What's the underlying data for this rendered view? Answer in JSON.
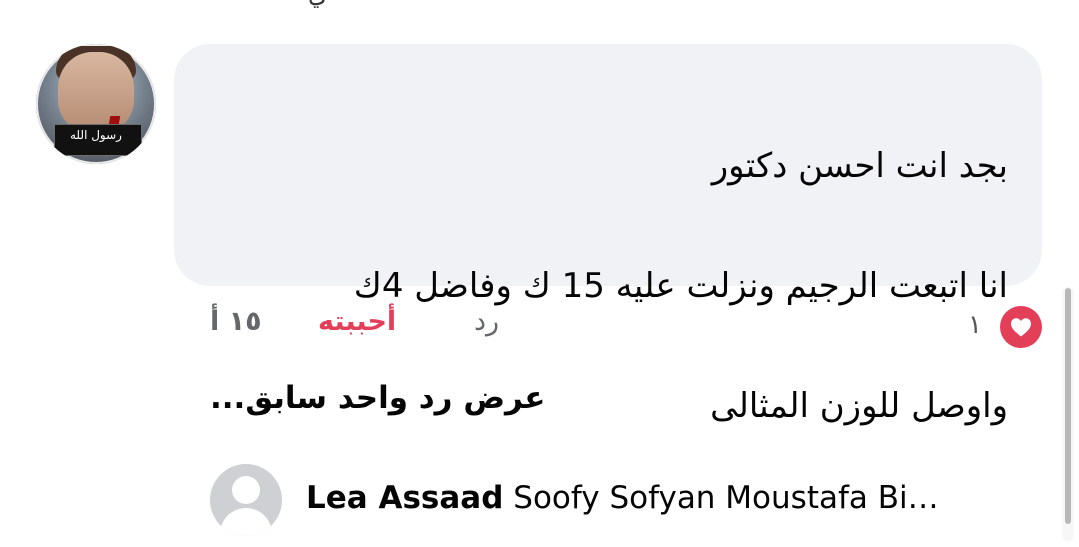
{
  "fragment": {
    "top_text": "ي"
  },
  "comment": {
    "lines": [
      "بجد انت احسن دكتور",
      "انا اتبعت الرجيم ونزلت عليه 15 ك وفاضل 4ك",
      "واوصل للوزن المثالى"
    ],
    "avatar_text": "رسول الله"
  },
  "reactions": {
    "count": "١",
    "icon": "heart-icon",
    "color": "#e33f58"
  },
  "actions": {
    "reply_label": "رد",
    "liked_label": "أحببته",
    "time_label": "١٥ أ"
  },
  "replies": {
    "previous_label": "عرض رد واحد سابق...",
    "author": "Lea Assaad",
    "snippet": " Soofy Sofyan Moustafa Bi…"
  },
  "colors": {
    "bubble": "#f0f2f5",
    "secondary_text": "#65676b",
    "avatar_placeholder": "#ced0d4"
  }
}
